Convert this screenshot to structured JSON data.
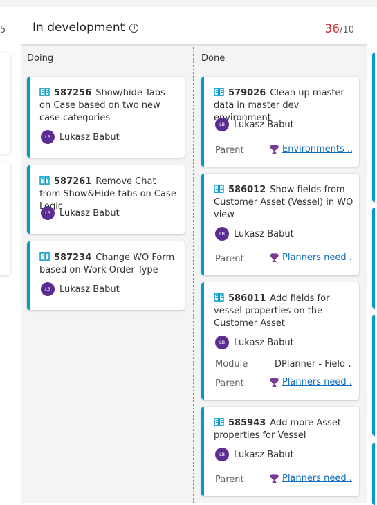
{
  "previous_column": {
    "count_fragment": "5"
  },
  "column": {
    "title": "In development",
    "info_icon": "info-icon",
    "wip_current": "36",
    "wip_limit": "/10"
  },
  "lanes": {
    "doing": {
      "label": "Doing"
    },
    "done": {
      "label": "Done"
    }
  },
  "doing_cards": [
    {
      "id": "587256",
      "title": "Show/hide Tabs on Case based on two new case categories",
      "assignee": "Lukasz Babut",
      "initials": "LB"
    },
    {
      "id": "587261",
      "title": "Remove Chat from Show&Hide tabs on Case Logic",
      "assignee": "Lukasz Babut",
      "initials": "LB"
    },
    {
      "id": "587234",
      "title": "Change WO Form based on Work Order Type",
      "assignee": "Lukasz Babut",
      "initials": "LB"
    }
  ],
  "done_cards": [
    {
      "id": "579026",
      "title": "Clean up master data in master dev environment",
      "assignee": "Lukasz Babut",
      "initials": "LB",
      "parent_label": "Parent",
      "parent": "Environments ..."
    },
    {
      "id": "586012",
      "title": "Show fields from Customer Asset (Vessel) in WO view",
      "assignee": "Lukasz Babut",
      "initials": "LB",
      "parent_label": "Parent",
      "parent": "Planners need ..."
    },
    {
      "id": "586011",
      "title": "Add fields for vessel properties on the Customer Asset",
      "assignee": "Lukasz Babut",
      "initials": "LB",
      "module_label": "Module",
      "module": "DPlanner - Field ...",
      "parent_label": "Parent",
      "parent": "Planners need ..."
    },
    {
      "id": "585943",
      "title": "Add more Asset properties for Vessel",
      "assignee": "Lukasz Babut",
      "initials": "LB",
      "parent_label": "Parent",
      "parent": "Planners need ..."
    }
  ],
  "colors": {
    "accent": "#009ccc",
    "wip_over": "#d13438",
    "avatar": "#5c2d91",
    "link": "#106ebe",
    "trophy": "#773b93"
  }
}
